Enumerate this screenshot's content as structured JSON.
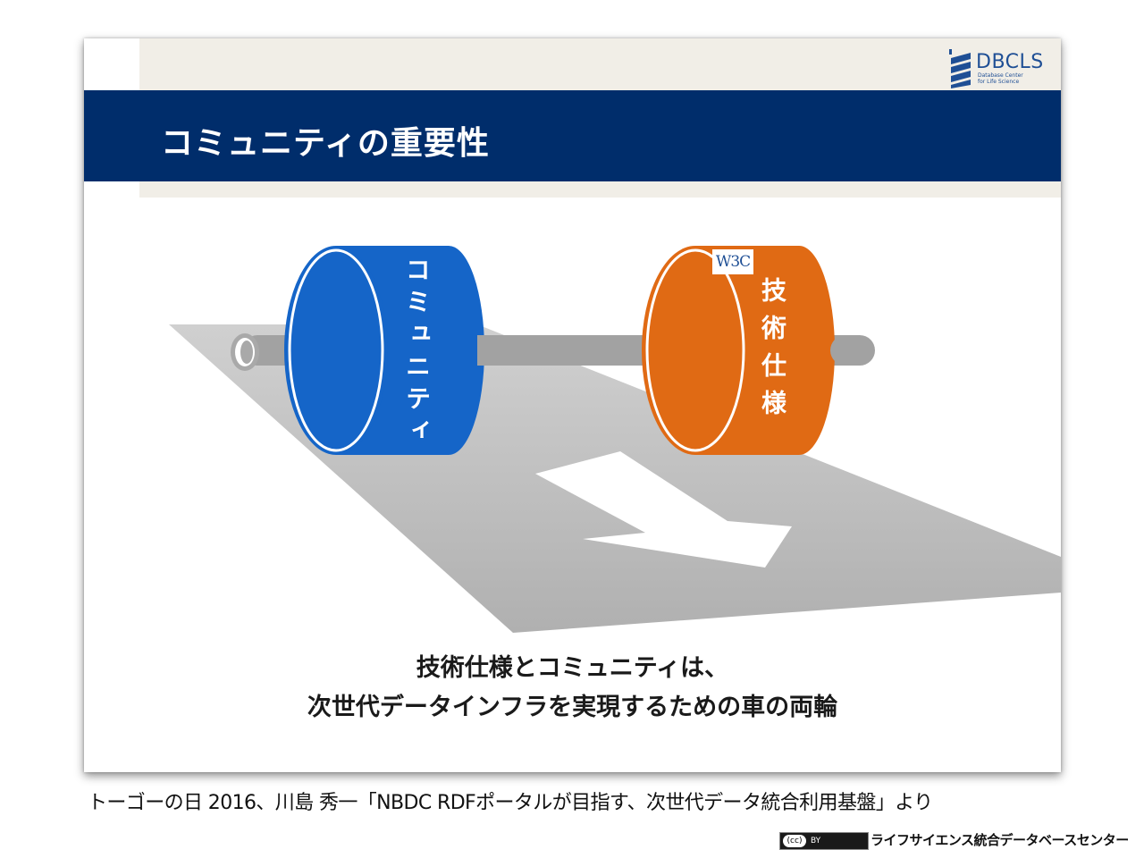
{
  "slide": {
    "title": "コミュニティの重要性",
    "logo": {
      "name": "DBCLS",
      "subtitle_line1": "Database Center",
      "subtitle_line2": "for Life Science"
    },
    "illustration": {
      "left_wheel_label": "コミュニティ",
      "right_wheel_label": "技術仕様",
      "right_wheel_badge": "W3C",
      "colors": {
        "left_wheel": "#1565c8",
        "right_wheel": "#e06a14",
        "axle": "#a0a0a0",
        "road": "#b3b3b3"
      }
    },
    "caption_line1": "技術仕様とコミュニティは、",
    "caption_line2": "次世代データインフラを実現するための車の両輪"
  },
  "source_note": "トーゴーの日 2016、川島 秀一「NBDC RDFポータルが目指す、次世代データ統合利用基盤」より",
  "license": {
    "badge_cc": "(cc)",
    "badge_by": "BY"
  },
  "organization": "ライフサイエンス統合データベースセンター",
  "colors": {
    "title_bar": "#002d6b",
    "accent_band": "#f1eee7"
  }
}
